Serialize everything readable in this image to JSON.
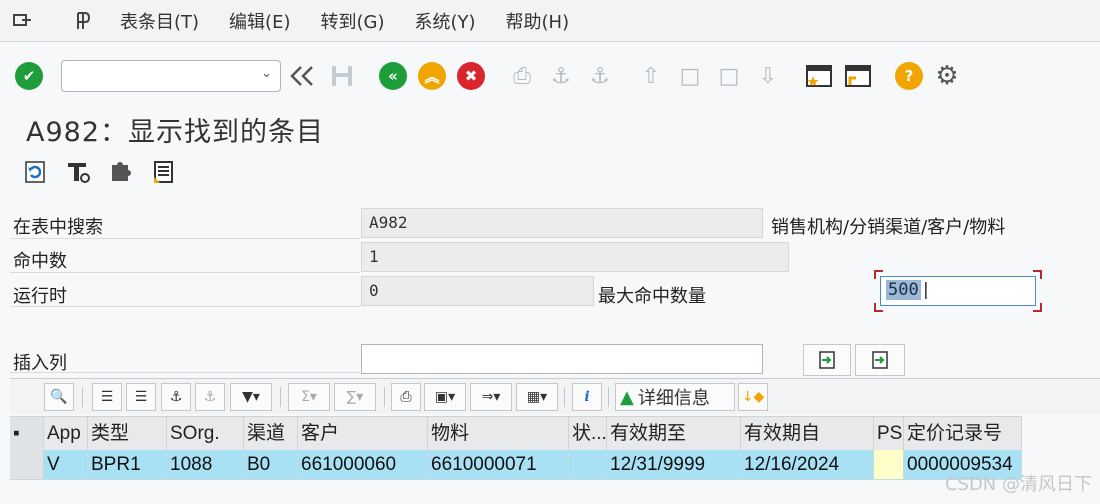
{
  "menu": {
    "items": [
      "表条目(T)",
      "编辑(E)",
      "转到(G)",
      "系统(Y)",
      "帮助(H)"
    ]
  },
  "toolbar": {
    "command_value": ""
  },
  "page": {
    "title": "A982：显示找到的条目"
  },
  "form": {
    "search_label": "在表中搜索",
    "search_value": "A982",
    "search_desc": "销售机构/分销渠道/客户/物料",
    "hits_label": "命中数",
    "hits_value": "1",
    "runtime_label": "运行时",
    "runtime_value": "0",
    "max_hits_label": "最大命中数量",
    "max_hits_value": "500",
    "insert_col_label": "插入列",
    "insert_col_value": ""
  },
  "alv": {
    "detail_label": "详细信息"
  },
  "table": {
    "columns": [
      "App",
      "类型",
      "SOrg.",
      "渠道",
      "客户",
      "物料",
      "状...",
      "有效期至",
      "有效期自",
      "PS",
      "定价记录号"
    ],
    "rows": [
      [
        "V",
        "BPR1",
        "1088",
        "B0",
        "661000060",
        "6610000071",
        "",
        "12/31/9999",
        "12/16/2024",
        "",
        "0000009534"
      ]
    ]
  },
  "watermark": "CSDN @清风日下",
  "colors": {
    "ok_green": "#1e9e3a",
    "back_green": "#1e9e3a",
    "exit_orange": "#f0a500",
    "cancel_red": "#d9262c",
    "help_orange": "#f0a500",
    "row_highlight": "#a9e1f4"
  }
}
